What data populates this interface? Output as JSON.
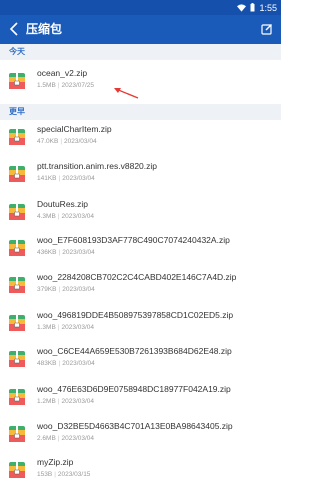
{
  "status_bar": {
    "time": "1:55"
  },
  "app_bar": {
    "title": "压缩包"
  },
  "sections": [
    {
      "label": "今天"
    },
    {
      "label": "更早"
    }
  ],
  "colors": {
    "primary": "#1a5ab8",
    "section_text": "#2f6cc5",
    "arrow": "#e53935"
  },
  "files": [
    {
      "name": "ocean_v2.zip",
      "size": "1.5MB",
      "date": "2023/07/25"
    },
    {
      "name": "specialCharItem.zip",
      "size": "47.0KB",
      "date": "2023/03/04"
    },
    {
      "name": "ptt.transition.anim.res.v8820.zip",
      "size": "141KB",
      "date": "2023/03/04"
    },
    {
      "name": "DoutuRes.zip",
      "size": "4.3MB",
      "date": "2023/03/04"
    },
    {
      "name": "woo_E7F608193D3AF778C490C7074240432A.zip",
      "size": "436KB",
      "date": "2023/03/04"
    },
    {
      "name": "woo_2284208CB702C2C4CABD402E146C7A4D.zip",
      "size": "379KB",
      "date": "2023/03/04"
    },
    {
      "name": "woo_496819DDE4B508975397858CD1C02ED5.zip",
      "size": "1.3MB",
      "date": "2023/03/04"
    },
    {
      "name": "woo_C6CE44A659E530B7261393B684D62E48.zip",
      "size": "483KB",
      "date": "2023/03/04"
    },
    {
      "name": "woo_476E63D6D9E0758948DC18977F042A19.zip",
      "size": "1.2MB",
      "date": "2023/03/04"
    },
    {
      "name": "woo_D32BE5D4663B4C701A13E0BA98643405.zip",
      "size": "2.6MB",
      "date": "2023/03/04"
    },
    {
      "name": "myZip.zip",
      "size": "153B",
      "date": "2023/03/15"
    }
  ]
}
